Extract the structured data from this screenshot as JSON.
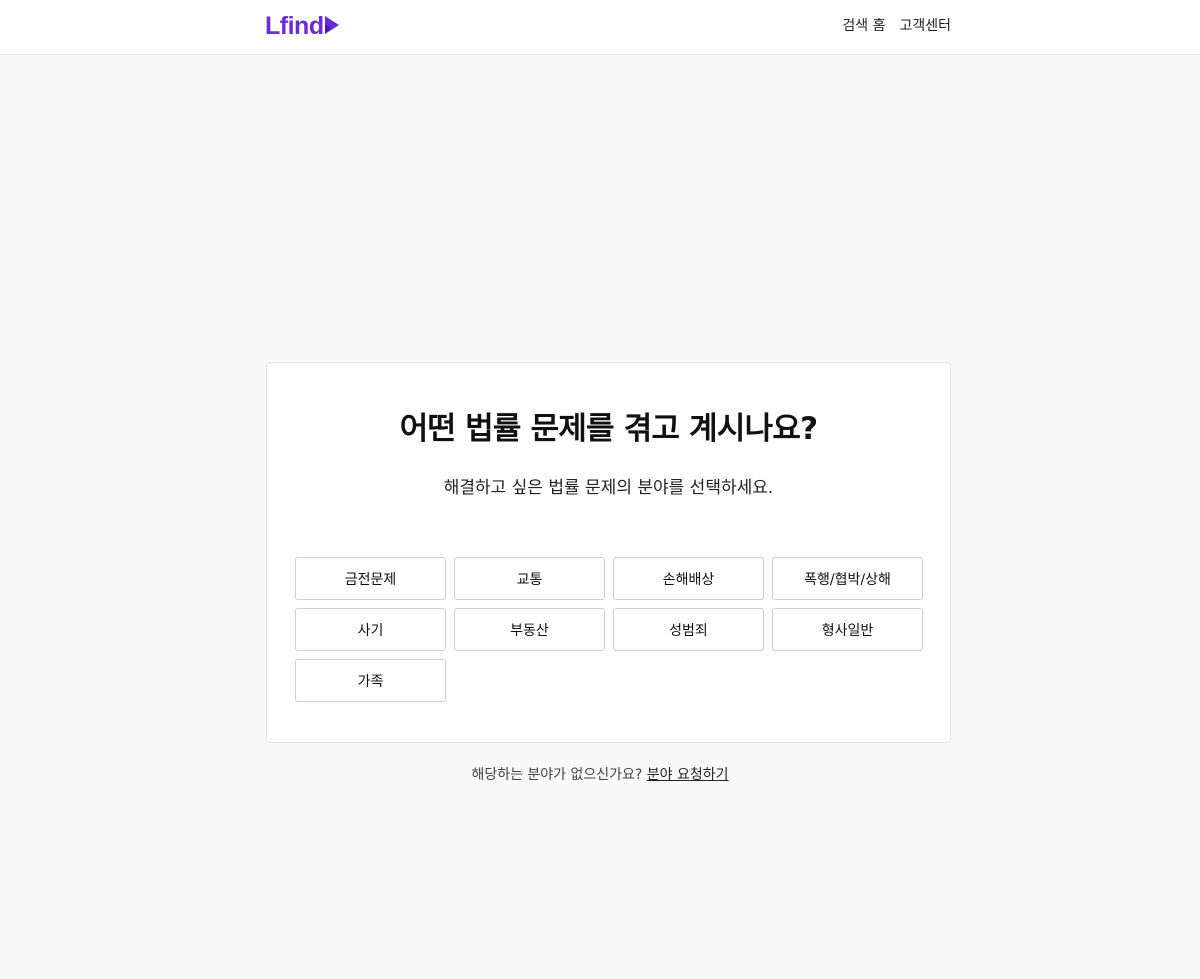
{
  "header": {
    "logo_text": "Lfind",
    "brand_color": "#6b2bd9",
    "nav": [
      {
        "label": "검색 홈"
      },
      {
        "label": "고객센터"
      }
    ]
  },
  "main": {
    "title": "어떤 법률 문제를 겪고 계시나요?",
    "subtitle": "해결하고 싶은 법률 문제의 분야를 선택하세요.",
    "categories": [
      {
        "label": "금전문제"
      },
      {
        "label": "교통"
      },
      {
        "label": "손해배상"
      },
      {
        "label": "폭행/협박/상해"
      },
      {
        "label": "사기"
      },
      {
        "label": "부동산"
      },
      {
        "label": "성범죄"
      },
      {
        "label": "형사일반"
      },
      {
        "label": "가족"
      }
    ]
  },
  "footer": {
    "question": "해당하는 분야가 없으신가요?",
    "request_link": "분야 요청하기"
  }
}
